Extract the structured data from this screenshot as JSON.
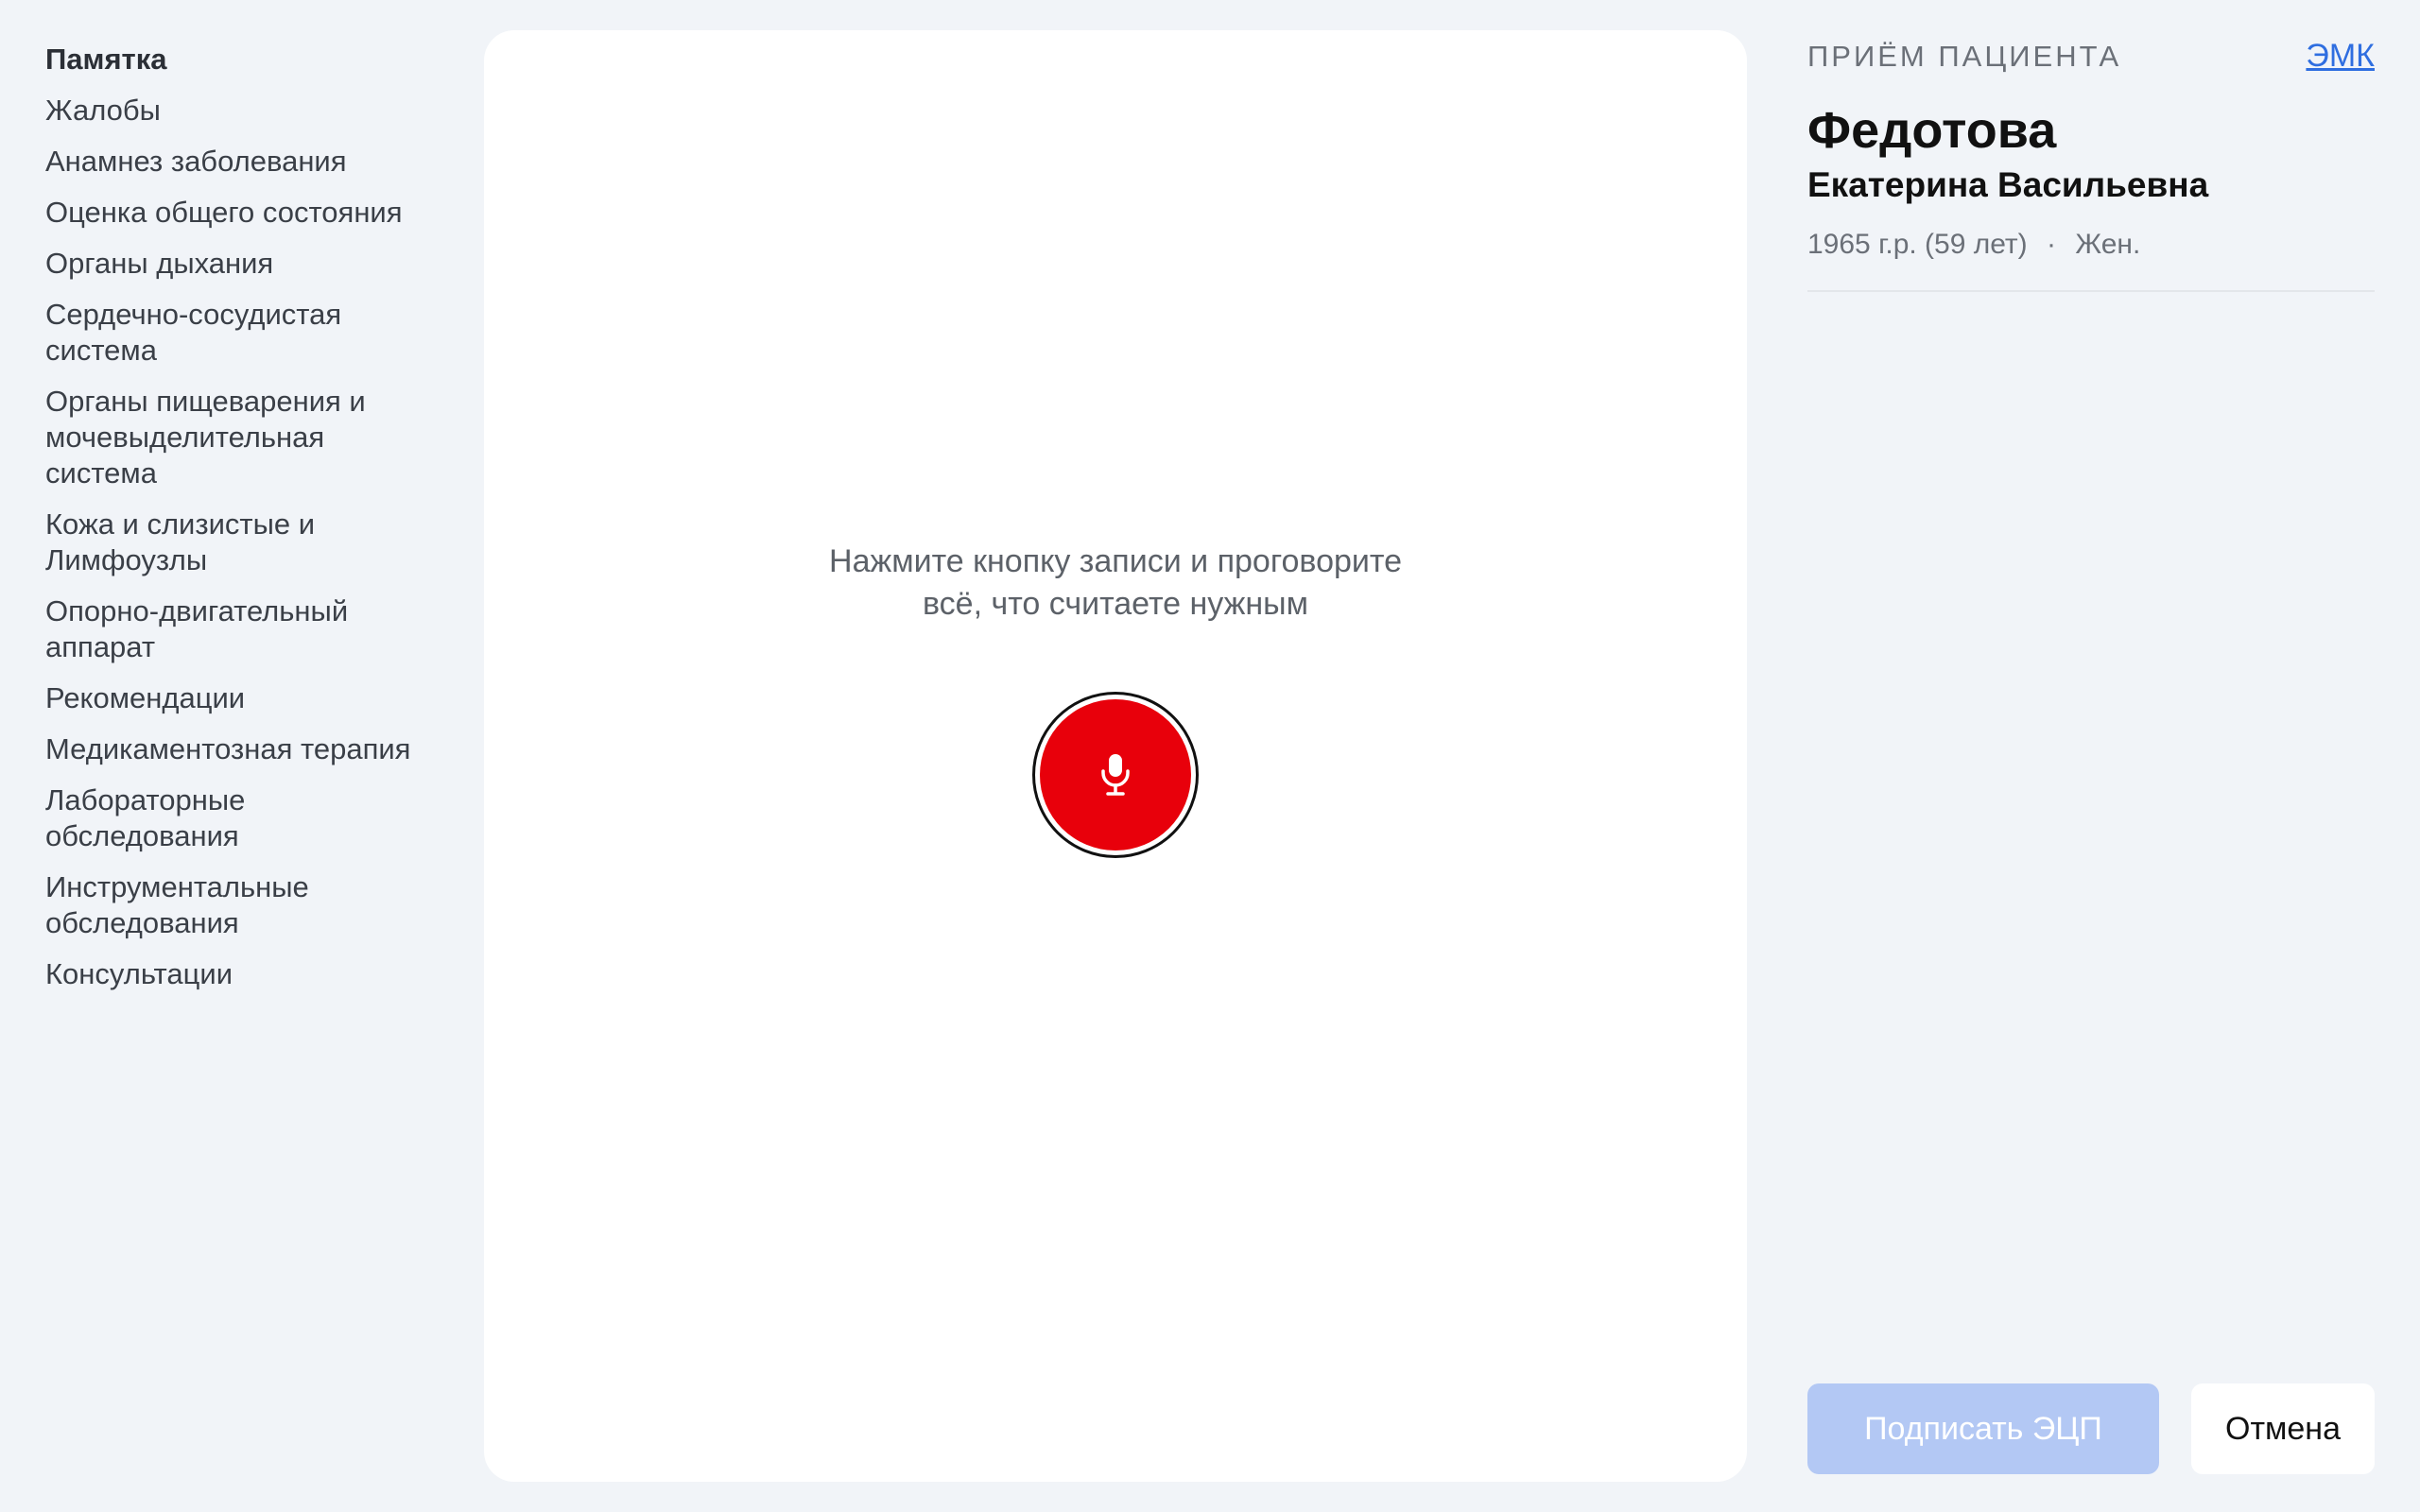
{
  "sidebar": {
    "items": [
      {
        "label": "Памятка"
      },
      {
        "label": "Жалобы"
      },
      {
        "label": "Анамнез заболевания"
      },
      {
        "label": "Оценка общего состояния"
      },
      {
        "label": "Органы дыхания"
      },
      {
        "label": "Сердечно-сосудистая система"
      },
      {
        "label": "Органы пищеварения и мочевыделительная система"
      },
      {
        "label": "Кожа и слизистые и Лимфоузлы"
      },
      {
        "label": "Опорно-двигательный аппарат"
      },
      {
        "label": "Рекомендации"
      },
      {
        "label": "Медикаментозная терапия"
      },
      {
        "label": "Лабораторные обследования"
      },
      {
        "label": "Инструментальные обследования"
      },
      {
        "label": "Консультации"
      }
    ]
  },
  "main": {
    "prompt_line1": "Нажмите кнопку записи и проговорите",
    "prompt_line2": "всё, что считаете нужным",
    "record_icon": "microphone-icon",
    "record_color": "#e8000b"
  },
  "patient": {
    "section_label": "ПРИЁМ ПАЦИЕНТА",
    "emk_link": "ЭМК",
    "last_name": "Федотова",
    "first_name": "Екатерина Васильевна",
    "birth": "1965 г.р. (59 лет)",
    "separator": "·",
    "sex": "Жен."
  },
  "actions": {
    "sign_label": "Подписать ЭЦП",
    "cancel_label": "Отмена"
  }
}
